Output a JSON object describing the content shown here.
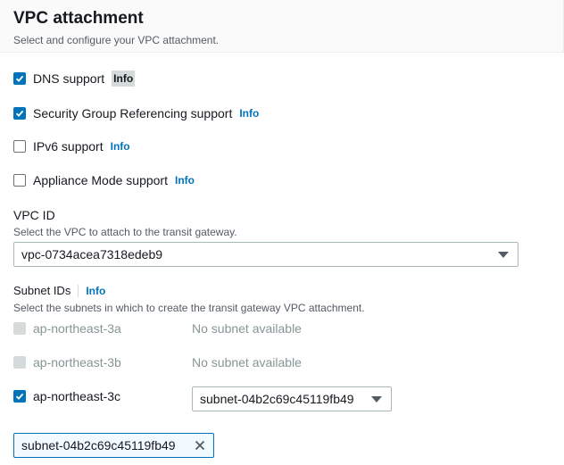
{
  "header": {
    "title": "VPC attachment",
    "subtitle": "Select and configure your VPC attachment."
  },
  "options": [
    {
      "label": "DNS support",
      "checked": true,
      "info": "Info"
    },
    {
      "label": "Security Group Referencing support",
      "checked": true,
      "info": "Info"
    },
    {
      "label": "IPv6 support",
      "checked": false,
      "info": "Info"
    },
    {
      "label": "Appliance Mode support",
      "checked": false,
      "info": "Info"
    }
  ],
  "vpc": {
    "label": "VPC ID",
    "description": "Select the VPC to attach to the transit gateway.",
    "value": "vpc-0734acea7318edeb9"
  },
  "subnets": {
    "label": "Subnet IDs",
    "info": "Info",
    "description": "Select the subnets in which to create the transit gateway VPC attachment.",
    "zones": [
      {
        "zone": "ap-northeast-3a",
        "status": "No subnet available",
        "checked": false,
        "disabled": true
      },
      {
        "zone": "ap-northeast-3b",
        "status": "No subnet available",
        "checked": false,
        "disabled": true
      },
      {
        "zone": "ap-northeast-3c",
        "selected_subnet": "subnet-04b2c69c45119fb49",
        "checked": true,
        "disabled": false
      }
    ],
    "token": "subnet-04b2c69c45119fb49"
  },
  "colors": {
    "accent": "#0073bb",
    "text": "#16191f",
    "muted": "#545b64",
    "disabled": "#879596"
  },
  "icons": [
    "checkbox-checked-icon",
    "caret-down-icon",
    "close-icon"
  ]
}
